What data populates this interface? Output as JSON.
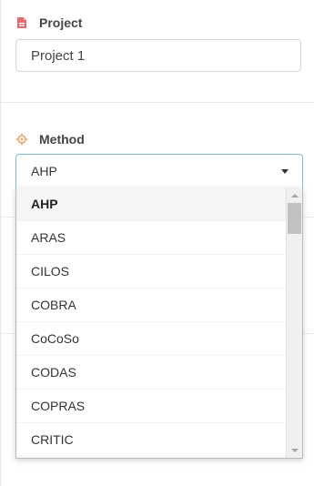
{
  "project": {
    "label": "Project",
    "icon": "file-icon",
    "icon_color": "#e26b6b",
    "value": "Project 1"
  },
  "method": {
    "label": "Method",
    "icon": "target-icon",
    "icon_color": "#f0a060",
    "selected": "AHP",
    "options": [
      "AHP",
      "ARAS",
      "CILOS",
      "COBRA",
      "CoCoSo",
      "CODAS",
      "COPRAS",
      "CRITIC"
    ],
    "accent_border": "#7ab8e6"
  }
}
